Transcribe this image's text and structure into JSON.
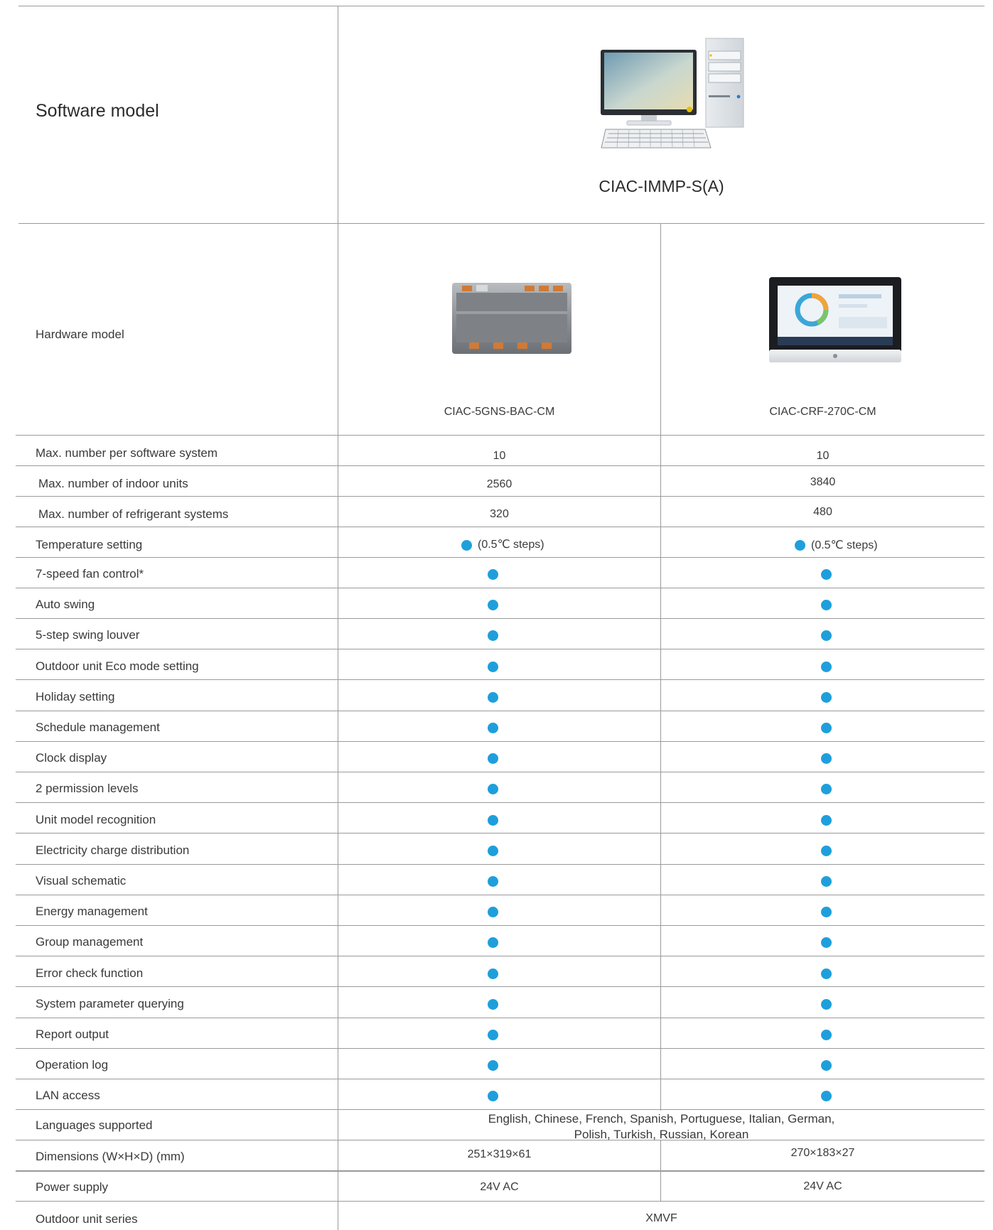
{
  "header": {
    "software_label": "Software model",
    "software_model": "CIAC-IMMP-S(A)",
    "hardware_label": "Hardware model",
    "hardware_models": [
      "CIAC-5GNS-BAC-CM",
      "CIAC-CRF-270C-CM"
    ]
  },
  "rows": {
    "max_per_system": {
      "label": "Max. number per software system",
      "v1": "10",
      "v2": "10"
    },
    "max_indoor": {
      "label": "Max. number of indoor units",
      "v1": "2560",
      "v2": "3840"
    },
    "max_refrigerant": {
      "label": "Max. number of refrigerant systems",
      "v1": "320",
      "v2": "480"
    },
    "temperature": {
      "label": "Temperature setting",
      "note": "(0.5℃ steps)"
    },
    "features": [
      "7-speed fan control*",
      "Auto swing",
      "5-step swing louver",
      "Outdoor unit Eco mode setting",
      "Holiday setting",
      "Schedule management",
      "Clock display",
      "2 permission levels",
      "Unit model recognition",
      "Electricity charge distribution",
      "Visual schematic",
      "Energy management",
      "Group management",
      "Error check function",
      "System parameter querying",
      "Report output",
      "Operation log",
      "LAN access"
    ],
    "languages": {
      "label": "Languages supported",
      "line1": "English, Chinese, French, Spanish, Portuguese, Italian, German,",
      "line2": "Polish, Turkish, Russian, Korean"
    },
    "dimensions": {
      "label": "Dimensions (W×H×D) (mm)",
      "v1": "251×319×61",
      "v2": "270×183×27"
    },
    "power": {
      "label": "Power supply",
      "v1": "24V AC",
      "v2": "24V AC"
    },
    "outdoor": {
      "label": "Outdoor unit series",
      "value": "XMVF"
    }
  },
  "colors": {
    "dot": "#1e9fdc",
    "rule": "#9a9a9a",
    "text": "#3a3a3a"
  },
  "icons": [
    "desktop-computer-icon",
    "din-rail-gateway-icon",
    "touch-panel-icon"
  ]
}
